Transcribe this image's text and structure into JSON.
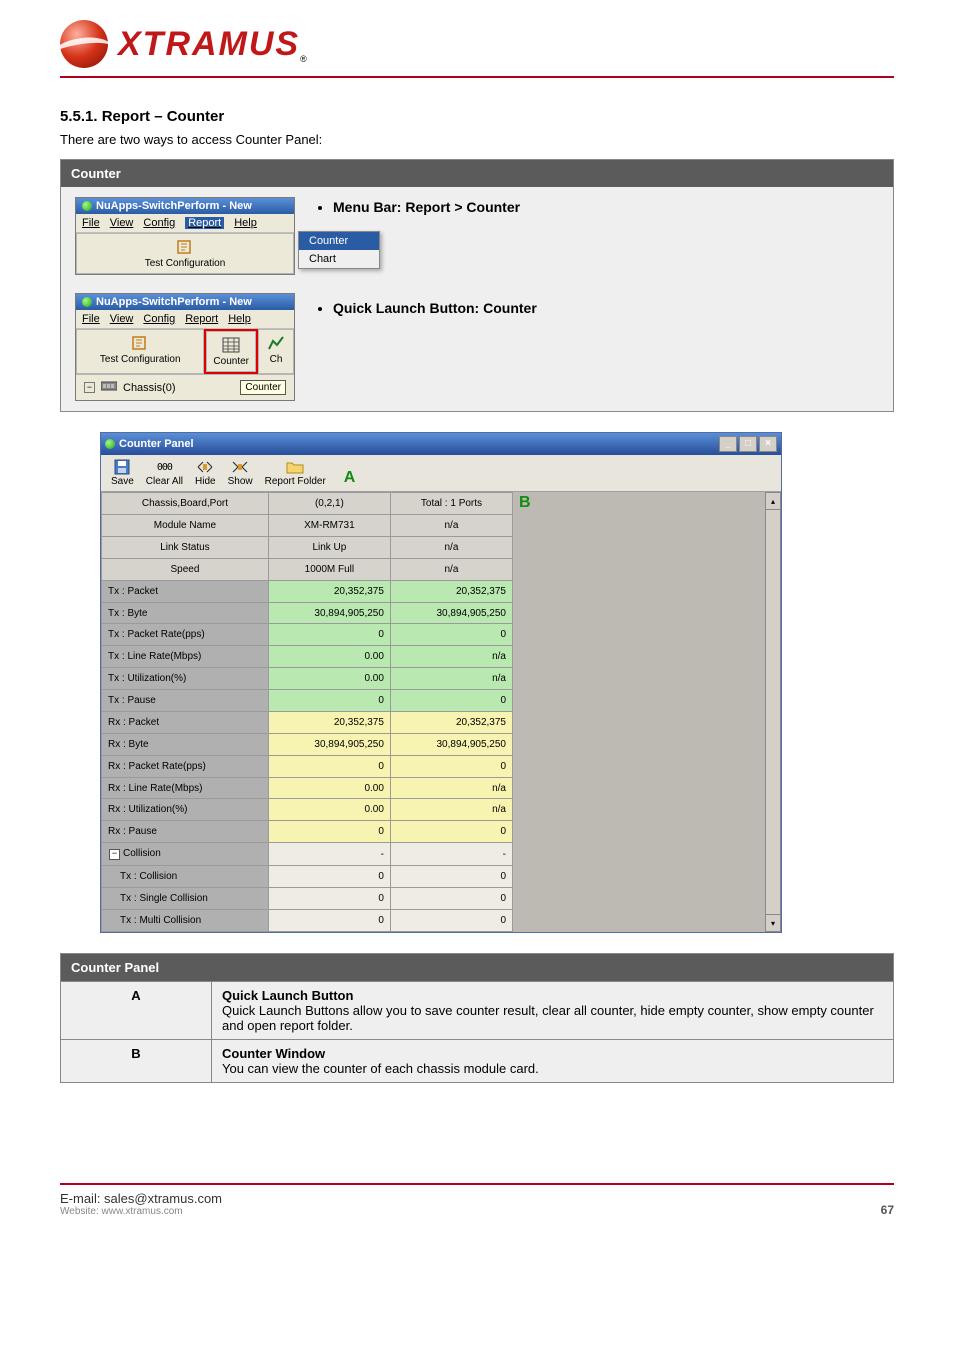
{
  "logo_text": "XTRAMUS",
  "section": {
    "title": "5.5.1. Report – Counter",
    "desc": "There are two ways to access Counter Panel:"
  },
  "menu_box": {
    "header": "Counter",
    "app_title": "NuApps-SwitchPerform - New",
    "menus": [
      "File",
      "View",
      "Config",
      "Report",
      "Help"
    ],
    "dropdown": [
      "Counter",
      "Chart"
    ],
    "toolbar_labels": {
      "test_config": "Test Configuration",
      "counter": "Counter",
      "chart": "Ch"
    },
    "tree_chassis": "Chassis(0)",
    "tooltip": "Counter",
    "bullet1": "Menu Bar: Report > Counter",
    "bullet2": "Quick Launch Button: Counter"
  },
  "counter_panel": {
    "title": "Counter Panel",
    "toolbar": [
      "Save",
      "Clear All",
      "Hide",
      "Show",
      "Report Folder"
    ],
    "marker_a": "A",
    "marker_b": "B",
    "rows": [
      {
        "type": "info",
        "label": "Chassis,Board,Port",
        "c1": "(0,2,1)",
        "c2": "Total : 1 Ports"
      },
      {
        "type": "info",
        "label": "Module Name",
        "c1": "XM-RM731",
        "c2": "n/a"
      },
      {
        "type": "info",
        "label": "Link Status",
        "c1": "Link Up",
        "c2": "n/a"
      },
      {
        "type": "info",
        "label": "Speed",
        "c1": "1000M Full",
        "c2": "n/a"
      },
      {
        "type": "tx",
        "label": "Tx : Packet",
        "c1": "20,352,375",
        "c2": "20,352,375"
      },
      {
        "type": "tx",
        "label": "Tx : Byte",
        "c1": "30,894,905,250",
        "c2": "30,894,905,250"
      },
      {
        "type": "tx",
        "label": "Tx : Packet Rate(pps)",
        "c1": "0",
        "c2": "0"
      },
      {
        "type": "tx",
        "label": "Tx : Line Rate(Mbps)",
        "c1": "0.00",
        "c2": "n/a"
      },
      {
        "type": "tx",
        "label": "Tx : Utilization(%)",
        "c1": "0.00",
        "c2": "n/a"
      },
      {
        "type": "tx",
        "label": "Tx : Pause",
        "c1": "0",
        "c2": "0"
      },
      {
        "type": "rx",
        "label": "Rx : Packet",
        "c1": "20,352,375",
        "c2": "20,352,375"
      },
      {
        "type": "rx",
        "label": "Rx : Byte",
        "c1": "30,894,905,250",
        "c2": "30,894,905,250"
      },
      {
        "type": "rx",
        "label": "Rx : Packet Rate(pps)",
        "c1": "0",
        "c2": "0"
      },
      {
        "type": "rx",
        "label": "Rx : Line Rate(Mbps)",
        "c1": "0.00",
        "c2": "n/a"
      },
      {
        "type": "rx",
        "label": "Rx : Utilization(%)",
        "c1": "0.00",
        "c2": "n/a"
      },
      {
        "type": "rx",
        "label": "Rx : Pause",
        "c1": "0",
        "c2": "0"
      },
      {
        "type": "plain",
        "label": "Collision",
        "c1": "-",
        "c2": "-",
        "expander": "−"
      },
      {
        "type": "plain",
        "label": "Tx : Collision",
        "c1": "0",
        "c2": "0",
        "tree": true
      },
      {
        "type": "plain",
        "label": "Tx : Single Collision",
        "c1": "0",
        "c2": "0",
        "tree": true
      },
      {
        "type": "plain",
        "label": "Tx : Multi Collision",
        "c1": "0",
        "c2": "0",
        "tree": true
      }
    ]
  },
  "desc_table": {
    "header": "Counter Panel",
    "rows": [
      {
        "a": "A",
        "title": "Quick Launch Button",
        "detail": "Quick Launch Buttons allow you to save counter result, clear all counter, hide empty counter, show empty counter and open report folder."
      },
      {
        "a": "B",
        "title": "Counter Window",
        "detail": "You can view the counter of each chassis module card."
      }
    ]
  },
  "footer": {
    "main": "E-mail: sales@xtramus.com",
    "sub": "Website: www.xtramus.com",
    "page": "67"
  }
}
